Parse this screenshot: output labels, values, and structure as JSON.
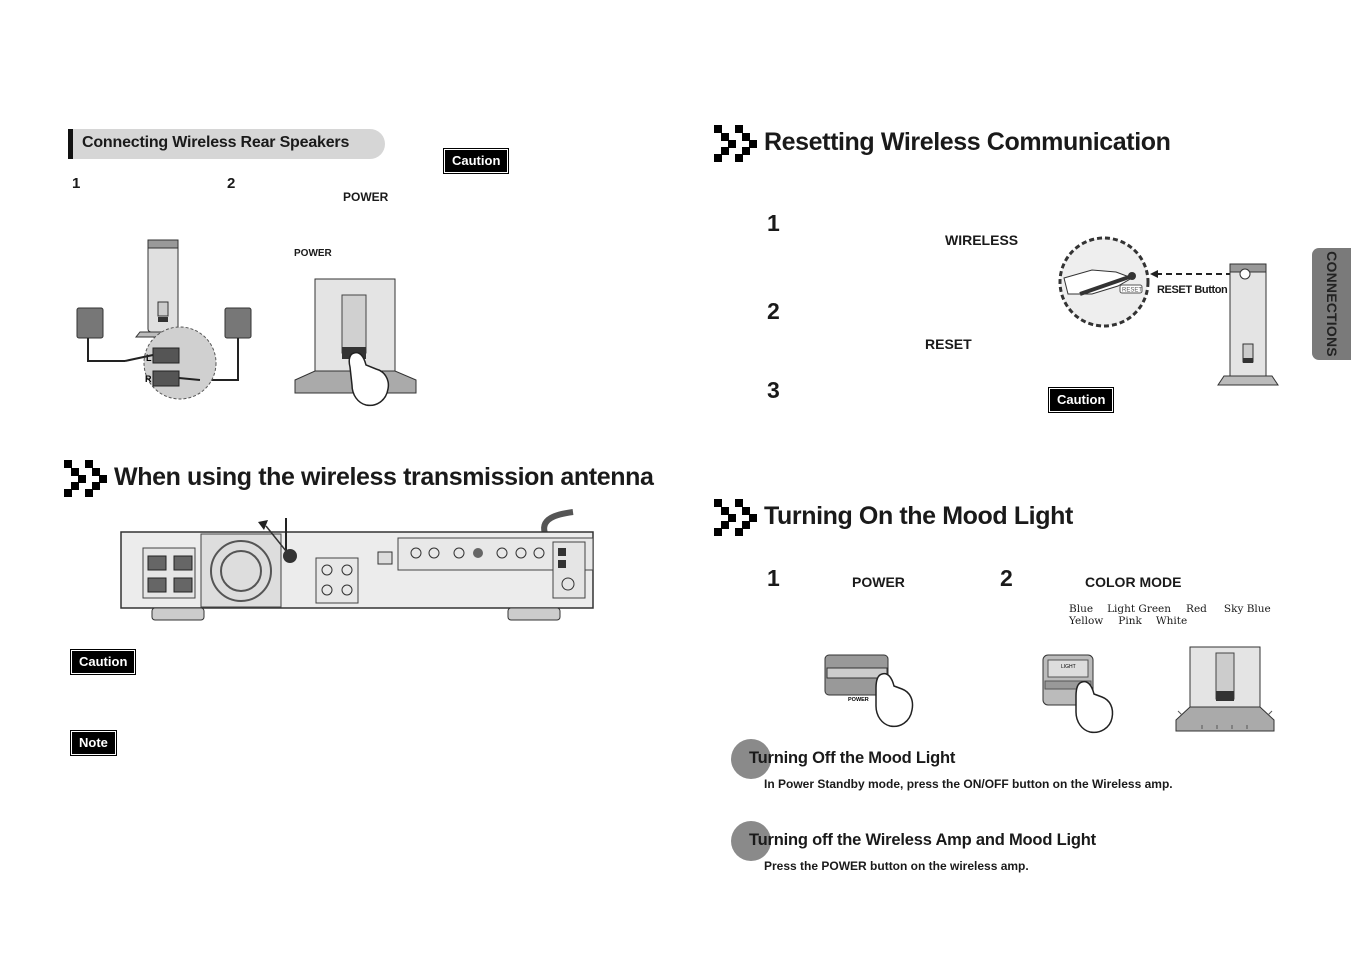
{
  "left_page": {
    "wireless_speakers": {
      "subheading": "Connecting Wireless Rear Speakers",
      "caution_label": "Caution",
      "step1_number": "1",
      "step2_number": "2",
      "step2_key": "POWER",
      "figure_key_label": "POWER",
      "speaker_labels": {
        "left": "L",
        "right": "R"
      }
    },
    "antenna": {
      "heading": "When using the wireless transmission antenna",
      "caution_label": "Caution",
      "note_label": "Note"
    }
  },
  "right_page": {
    "side_tab": "CONNECTIONS",
    "reset": {
      "heading": "Resetting Wireless Communication",
      "steps": [
        {
          "number": "1",
          "key": "WIRELESS"
        },
        {
          "number": "2",
          "key": "RESET"
        },
        {
          "number": "3",
          "key": ""
        }
      ],
      "figure_button_label": "RESET",
      "figure_callout": "RESET Button",
      "caution_label": "Caution"
    },
    "mood_light": {
      "heading": "Turning On the Mood Light",
      "step1": {
        "number": "1",
        "key": "POWER"
      },
      "step2": {
        "number": "2",
        "key": "COLOR MODE"
      },
      "color_sequence_line1": [
        "Blue",
        "Light Green",
        "Red",
        "Sky Blue"
      ],
      "color_sequence_line2": [
        "Yellow",
        "Pink",
        "White"
      ],
      "figure_power_label": "POWER",
      "figure_light_label": "LIGHT"
    },
    "turn_off_mood": {
      "title": "Turning Off the Mood Light",
      "body": "In Power Standby mode, press the ON/OFF button on the Wireless amp."
    },
    "turn_off_amp": {
      "title": "Turning off the Wireless Amp and Mood Light",
      "body": "Press the POWER button on the wireless amp."
    }
  }
}
